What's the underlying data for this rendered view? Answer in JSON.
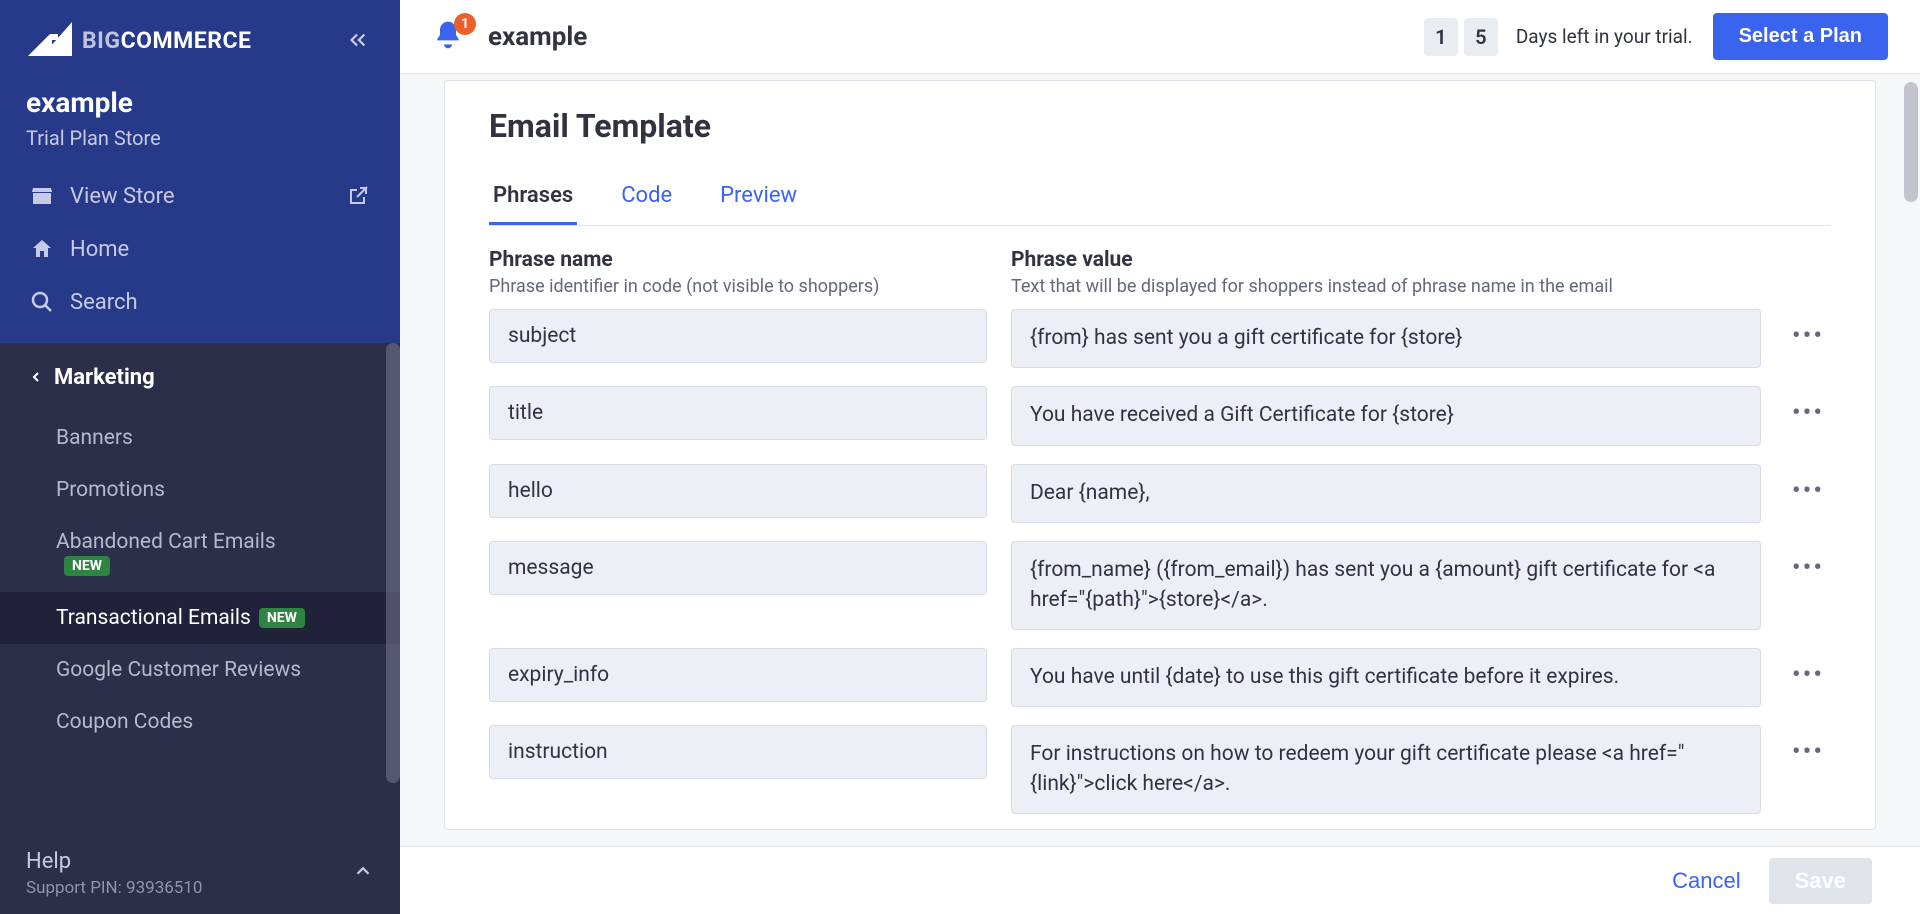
{
  "brand": {
    "name": "COMMERCE",
    "prefix": "BIG"
  },
  "store": {
    "name": "example",
    "plan": "Trial Plan Store"
  },
  "sidebar": {
    "view_store": "View Store",
    "home": "Home",
    "search": "Search",
    "section": "Marketing",
    "items": [
      {
        "label": "Banners",
        "new": false
      },
      {
        "label": "Promotions",
        "new": false
      },
      {
        "label": "Abandoned Cart Emails",
        "new": true
      },
      {
        "label": "Transactional Emails",
        "new": true,
        "active": true
      },
      {
        "label": "Google Customer Reviews",
        "new": false
      },
      {
        "label": "Coupon Codes",
        "new": false
      }
    ],
    "help": "Help",
    "pin_label": "Support PIN: ",
    "pin": "93936510"
  },
  "topbar": {
    "notification_count": "1",
    "title": "example",
    "day_digits": [
      "1",
      "5"
    ],
    "days_text": "Days left in your trial.",
    "select_plan": "Select a Plan"
  },
  "panel": {
    "title": "Email Template",
    "tabs": [
      "Phrases",
      "Code",
      "Preview"
    ],
    "col1_head": "Phrase name",
    "col1_hint": "Phrase identifier in code (not visible to shoppers)",
    "col2_head": "Phrase value",
    "col2_hint": "Text that will be displayed for shoppers instead of phrase name in the email",
    "rows": [
      {
        "name": "subject",
        "value": "{from} has sent you a gift certificate for {store}"
      },
      {
        "name": "title",
        "value": "You have received a Gift Certificate for {store}"
      },
      {
        "name": "hello",
        "value": "Dear {name},"
      },
      {
        "name": "message",
        "value": "{from_name} ({from_email}) has sent you a {amount} gift certificate for <a href=\"{path}\">{store}</a>."
      },
      {
        "name": "expiry_info",
        "value": "You have until {date} to use this gift certificate before it expires."
      },
      {
        "name": "instruction",
        "value": "For instructions on how to redeem your gift certificate please <a href=\"{link}\">click here</a>."
      }
    ]
  },
  "footer": {
    "cancel": "Cancel",
    "save": "Save"
  },
  "badge_new_text": "NEW"
}
